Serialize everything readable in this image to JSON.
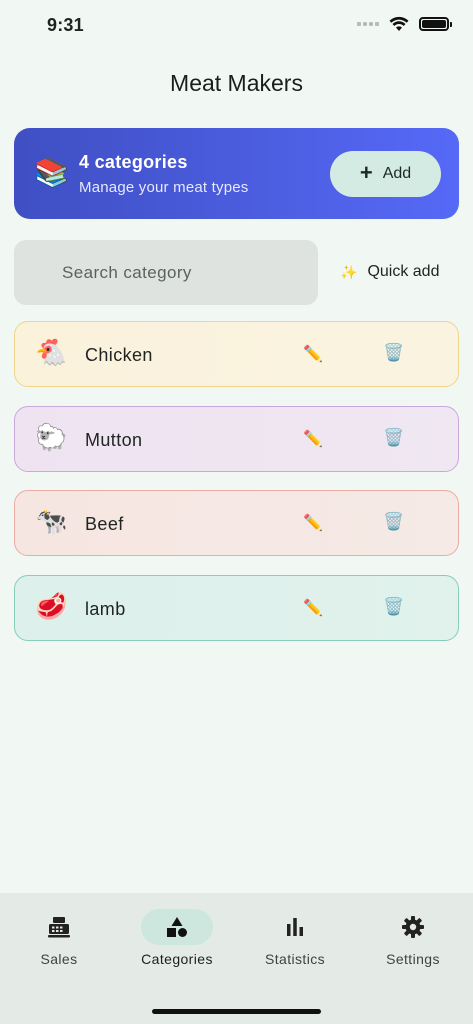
{
  "status": {
    "time": "9:31"
  },
  "app": {
    "title": "Meat Makers"
  },
  "hero": {
    "icon": "📚",
    "title": "4 categories",
    "subtitle": "Manage your meat types",
    "add_label": "Add",
    "add_icon": "+"
  },
  "search": {
    "placeholder": "Search category",
    "value": ""
  },
  "quick_add": {
    "icon": "✨",
    "label": "Quick add"
  },
  "categories": [
    {
      "emoji": "🐔",
      "name": "Chicken",
      "edit_icon": "✏️",
      "delete_icon": "🗑️",
      "border": "#f0d48b",
      "bg": "#fbf2dc"
    },
    {
      "emoji": "🐑",
      "name": "Mutton",
      "edit_icon": "✏️",
      "delete_icon": "🗑️",
      "border": "#c9a9dc",
      "bg": "#efe3f1"
    },
    {
      "emoji": "🐄",
      "name": "Beef",
      "edit_icon": "✏️",
      "delete_icon": "🗑️",
      "border": "#eeaaa4",
      "bg": "#f6e6e2"
    },
    {
      "emoji": "🥩",
      "name": "lamb",
      "edit_icon": "✏️",
      "delete_icon": "🗑️",
      "border": "#86cdba",
      "bg": "#ddf0eb"
    }
  ],
  "nav": {
    "items": [
      {
        "label": "Sales",
        "icon": "cash-register-icon",
        "active": false
      },
      {
        "label": "Categories",
        "icon": "shapes-icon",
        "active": true
      },
      {
        "label": "Statistics",
        "icon": "bar-chart-icon",
        "active": false
      },
      {
        "label": "Settings",
        "icon": "gear-icon",
        "active": false
      }
    ]
  },
  "colors": {
    "background": "#f1f8f3",
    "hero_start": "#3f4fc3",
    "hero_end": "#5669f7",
    "accent_pill": "#cde7de"
  }
}
